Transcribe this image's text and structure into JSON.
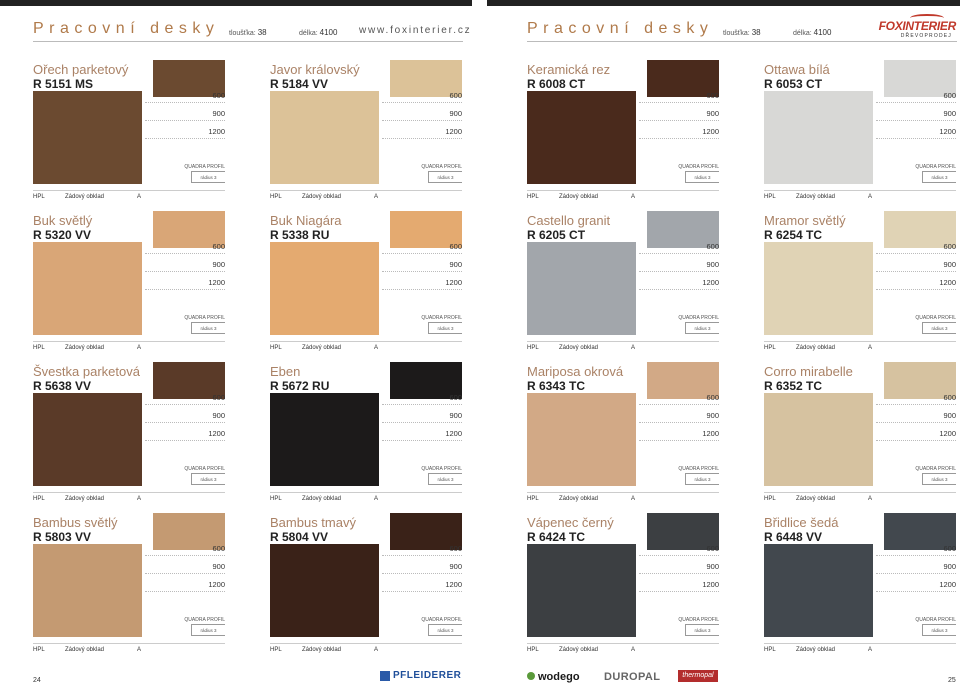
{
  "header": {
    "left_title": "Pracovní desky",
    "right_title": "Pracovní desky",
    "thickness_label": "tloušťka:",
    "thickness_value": "38",
    "length_label": "délka:",
    "length_value": "4100",
    "website": "www.foxinterier.cz",
    "logo_main": "FOXINTERIER",
    "logo_sub": "DŘEVOPRODEJ"
  },
  "panel_common": {
    "sizes": [
      "600",
      "900",
      "1200"
    ],
    "profile_label": "QUADRA PROFIL",
    "radius_label": "rádius 3",
    "footer": [
      "HPL",
      "Zádový obklad",
      "A"
    ]
  },
  "panels": [
    {
      "name": "Ořech parketový",
      "code": "R 5151 MS",
      "color": "#6b4a30"
    },
    {
      "name": "Javor královský",
      "code": "R 5184 VV",
      "color": "#dcc298"
    },
    {
      "name": "Keramická rez",
      "code": "R 6008 CT",
      "color": "#4a2a1c"
    },
    {
      "name": "Ottawa bílá",
      "code": "R 6053 CT",
      "color": "#d8d8d6"
    },
    {
      "name": "Buk světlý",
      "code": "R 5320 VV",
      "color": "#d9a677"
    },
    {
      "name": "Buk Niagára",
      "code": "R 5338 RU",
      "color": "#e4aa70"
    },
    {
      "name": "Castello granit",
      "code": "R 6205 CT",
      "color": "#a2a6ab"
    },
    {
      "name": "Mramor světlý",
      "code": "R 6254 TC",
      "color": "#e0d3b5"
    },
    {
      "name": "Švestka parketová",
      "code": "R 5638 VV",
      "color": "#5a3a28"
    },
    {
      "name": "Eben",
      "code": "R 5672 RU",
      "color": "#1c1a1a"
    },
    {
      "name": "Mariposa okrová",
      "code": "R 6343 TC",
      "color": "#d2a986"
    },
    {
      "name": "Corro mirabelle",
      "code": "R 6352 TC",
      "color": "#d6c2a0"
    },
    {
      "name": "Bambus světlý",
      "code": "R 5803 VV",
      "color": "#c49a72"
    },
    {
      "name": "Bambus tmavý",
      "code": "R 5804 VV",
      "color": "#3a2218"
    },
    {
      "name": "Vápenec černý",
      "code": "R 6424 TC",
      "color": "#3c3f42"
    },
    {
      "name": "Břidlice šedá",
      "code": "R 6448 VV",
      "color": "#42484e"
    }
  ],
  "footer": {
    "page_left": "24",
    "page_right": "25",
    "brand_pfleiderer": "PFLEIDERER",
    "brand_wodego": "wodego",
    "brand_duropal": "DUROPAL",
    "brand_thermopal": "thermopal"
  }
}
